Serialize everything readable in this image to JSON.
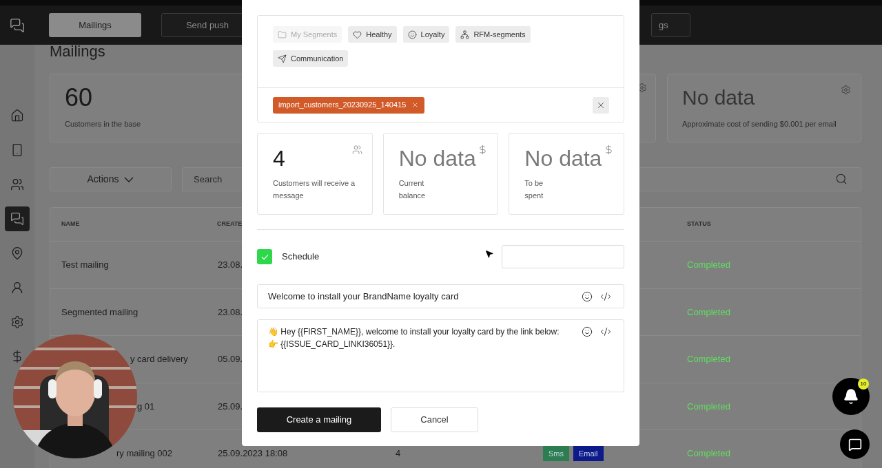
{
  "topbar": {
    "tabs": [
      {
        "label": "Mailings",
        "selected": true
      },
      {
        "label": "Send push",
        "selected": false
      },
      {
        "label": "gs",
        "selected": false
      }
    ]
  },
  "sidebar": {
    "items": [
      {
        "kind": "home",
        "selected": false
      },
      {
        "kind": "phone",
        "selected": false
      },
      {
        "kind": "users",
        "selected": false
      },
      {
        "kind": "chat",
        "selected": true
      },
      {
        "kind": "pin",
        "selected": false
      },
      {
        "kind": "user",
        "selected": false
      },
      {
        "kind": "settings",
        "selected": false
      },
      {
        "kind": "dollar",
        "selected": false
      }
    ]
  },
  "page": {
    "title": "Mailings"
  },
  "stats": [
    {
      "value": "60",
      "label": "Customers in the base"
    },
    {
      "value": "No data",
      "label": "Approximate cost of sending $0.001 per email"
    }
  ],
  "toolbar": {
    "actions": "Actions",
    "search_placeholder": "Search"
  },
  "table": {
    "columns": [
      "NAME",
      "CREATE",
      "STATUS"
    ],
    "rows": [
      {
        "name": "Test mailing",
        "created": "23.08.",
        "status": "Completed"
      },
      {
        "name": "Segmented mailing",
        "created": "23.08.",
        "status": "Completed"
      },
      {
        "name": "y card delivery",
        "created": "05.09.",
        "status": "Completed"
      },
      {
        "name": "g 01",
        "created": "25.09.",
        "status": "Completed"
      },
      {
        "name": "ry mailing 002",
        "created": "25.09.2023 18:08",
        "recipients": "4",
        "channels": [
          {
            "label": "Sms",
            "color": "#2c7d4f"
          },
          {
            "label": "Email",
            "color": "#0d1a8a"
          }
        ],
        "status": "Completed"
      }
    ]
  },
  "modal": {
    "segments": [
      {
        "label": "My Segments",
        "kind": "folder",
        "disabled": true
      },
      {
        "label": "Healthy",
        "kind": "heart",
        "disabled": false
      },
      {
        "label": "Loyalty",
        "kind": "smile",
        "disabled": false
      },
      {
        "label": "RFM-segments",
        "kind": "network",
        "disabled": false
      },
      {
        "label": "Communication",
        "kind": "send",
        "disabled": false
      }
    ],
    "selected_tags": [
      {
        "label": "import_customers_20230925_140415"
      }
    ],
    "stats": [
      {
        "value": "4",
        "label": "Customers will receive a message",
        "kind": "users",
        "empty": false
      },
      {
        "value": "No data",
        "label": "Current balance",
        "kind": "dollar",
        "empty": true
      },
      {
        "value": "No data",
        "label": "To be spent",
        "kind": "dollar",
        "empty": true
      }
    ],
    "schedule": {
      "label": "Schedule",
      "checked": true
    },
    "subject": {
      "value": "Welcome to install your BrandName loyalty card"
    },
    "message": {
      "value": "👋 Hey {{FIRST_NAME}}, welcome to install your loyalty card by the link below:\n👉 {{ISSUE_CARD_LINKI36051}}."
    },
    "buttons": [
      {
        "label": "Create a mailing",
        "kind": "primary"
      },
      {
        "label": "Cancel",
        "kind": "secondary"
      }
    ]
  },
  "notifications": {
    "count": "10"
  }
}
